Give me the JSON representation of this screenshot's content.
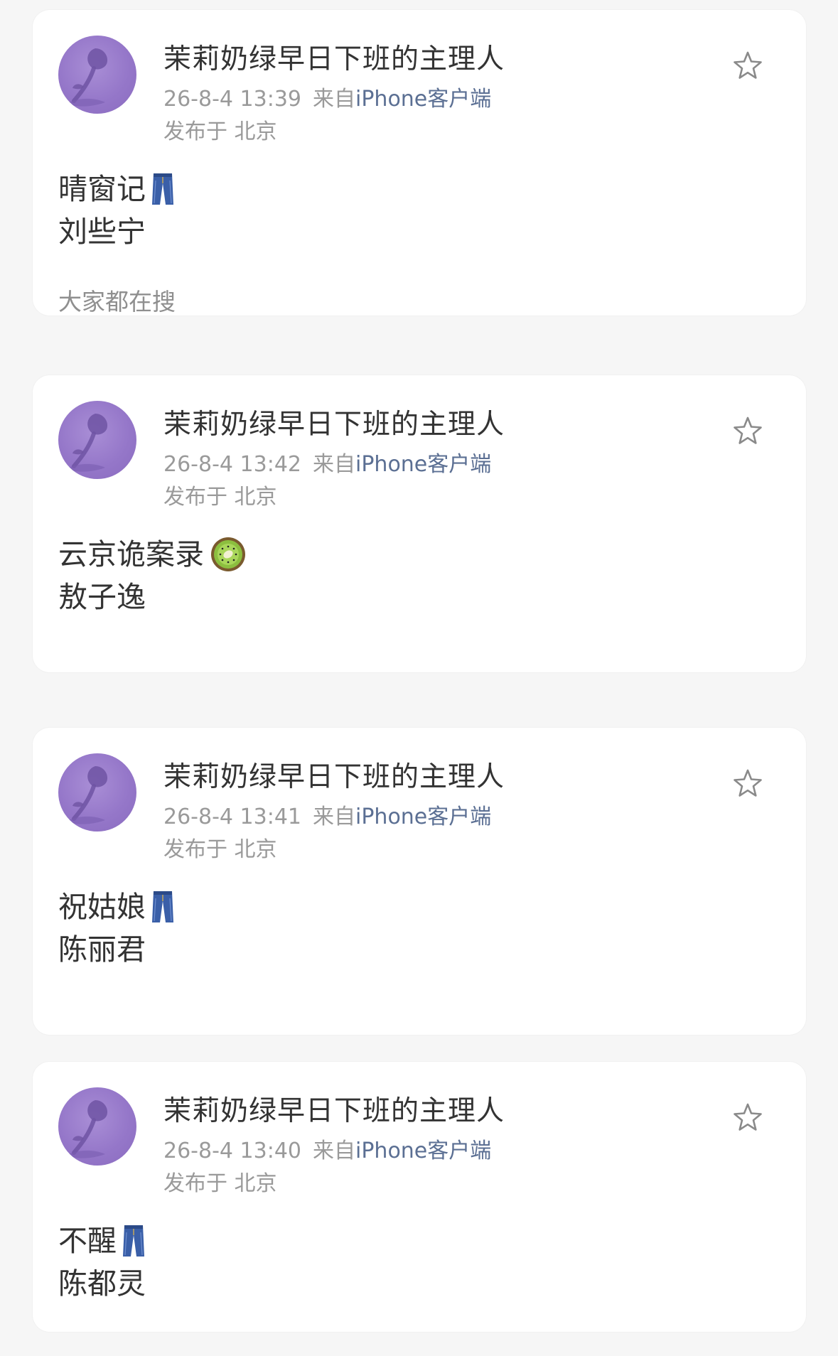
{
  "posts": [
    {
      "username": "茉莉奶绿早日下班的主理人",
      "time": "26-8-4 13:39",
      "source_prefix": "来自",
      "source_device": "iPhone客户端",
      "location": "发布于 北京",
      "line1": "晴窗记",
      "line1_emoji": "jeans-icon",
      "line2": "刘些宁",
      "search_hint": "大家都在搜"
    },
    {
      "username": "茉莉奶绿早日下班的主理人",
      "time": "26-8-4 13:42",
      "source_prefix": "来自",
      "source_device": "iPhone客户端",
      "location": "发布于 北京",
      "line1": "云京诡案录",
      "line1_emoji": "kiwi-icon",
      "line2": "敖子逸"
    },
    {
      "username": "茉莉奶绿早日下班的主理人",
      "time": "26-8-4 13:41",
      "source_prefix": "来自",
      "source_device": "iPhone客户端",
      "location": "发布于 北京",
      "line1": "祝姑娘",
      "line1_emoji": "jeans-icon",
      "line2": "陈丽君"
    },
    {
      "username": "茉莉奶绿早日下班的主理人",
      "time": "26-8-4 13:40",
      "source_prefix": "来自",
      "source_device": "iPhone客户端",
      "location": "发布于 北京",
      "line1": "不醒",
      "line1_emoji": "jeans-icon",
      "line2": "陈都灵"
    }
  ],
  "colors": {
    "avatar": "#9577c9",
    "device_link": "#5b6f93",
    "meta": "#9a9a9a",
    "star": "#8a8a8a"
  }
}
